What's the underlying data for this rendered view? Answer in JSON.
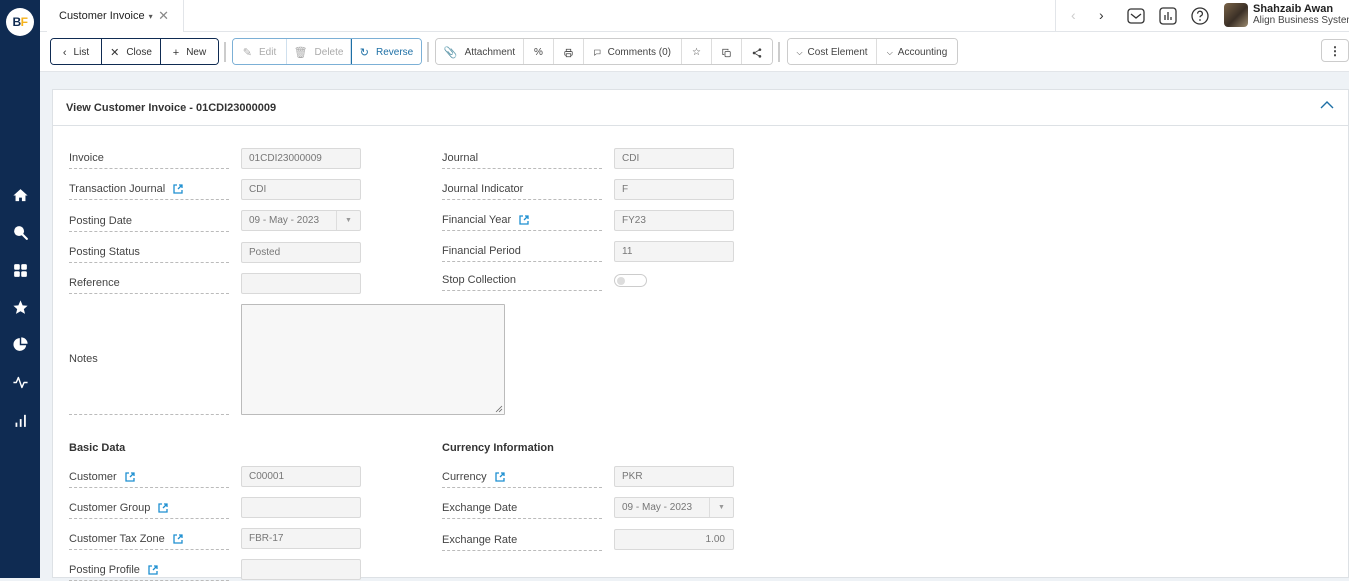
{
  "app": {
    "logo_text_b": "B",
    "logo_text_f": "F"
  },
  "sidebar": {
    "items": [
      {
        "icon": "home-icon"
      },
      {
        "icon": "search-icon"
      },
      {
        "icon": "apps-grid-icon"
      },
      {
        "icon": "star-icon"
      },
      {
        "icon": "pie-chart-icon"
      },
      {
        "icon": "activity-icon"
      },
      {
        "icon": "bar-chart-icon"
      }
    ]
  },
  "tabs": [
    {
      "label": "Customer Invoice",
      "caret": "▾",
      "close": "✕"
    }
  ],
  "header": {
    "nav_prev": "‹",
    "nav_next": "›",
    "user_name": "Shahzaib Awan",
    "user_org": "Align Business System"
  },
  "toolbar": {
    "list_label": "List",
    "close_label": "Close",
    "new_label": "New",
    "edit_label": "Edit",
    "delete_label": "Delete",
    "reverse_label": "Reverse",
    "attachment_label": "Attachment",
    "percent_label": "%",
    "comments_label": "Comments (0)",
    "cost_element_label": "Cost Element",
    "accounting_label": "Accounting",
    "more_label": "⋮"
  },
  "form": {
    "title": "View Customer Invoice - 01CDI23000009",
    "left": {
      "invoice": {
        "label": "Invoice",
        "value": "01CDI23000009"
      },
      "transaction_journal": {
        "label": "Transaction Journal",
        "value": "CDI"
      },
      "posting_date": {
        "label": "Posting Date",
        "value": "09 - May - 2023"
      },
      "posting_status": {
        "label": "Posting Status",
        "value": "Posted"
      },
      "reference": {
        "label": "Reference",
        "value": ""
      },
      "notes": {
        "label": "Notes",
        "value": ""
      }
    },
    "right": {
      "journal": {
        "label": "Journal",
        "value": "CDI"
      },
      "journal_indicator": {
        "label": "Journal Indicator",
        "value": "F"
      },
      "financial_year": {
        "label": "Financial Year",
        "value": "FY23"
      },
      "financial_period": {
        "label": "Financial Period",
        "value": "11"
      },
      "stop_collection": {
        "label": "Stop Collection",
        "value": false
      }
    },
    "basic_data": {
      "title": "Basic Data",
      "customer": {
        "label": "Customer",
        "value": "C00001"
      },
      "customer_group": {
        "label": "Customer Group",
        "value": ""
      },
      "customer_tax_zone": {
        "label": "Customer Tax Zone",
        "value": "FBR-17"
      },
      "posting_profile": {
        "label": "Posting Profile",
        "value": ""
      }
    },
    "currency_info": {
      "title": "Currency Information",
      "currency": {
        "label": "Currency",
        "value": "PKR"
      },
      "exchange_date": {
        "label": "Exchange Date",
        "value": "09 - May - 2023"
      },
      "exchange_rate": {
        "label": "Exchange Rate",
        "value": "1.00"
      }
    }
  },
  "colors": {
    "sidebar": "#0f2b52",
    "accent": "#1d6fa5",
    "logo_f": "#f5b21a"
  }
}
